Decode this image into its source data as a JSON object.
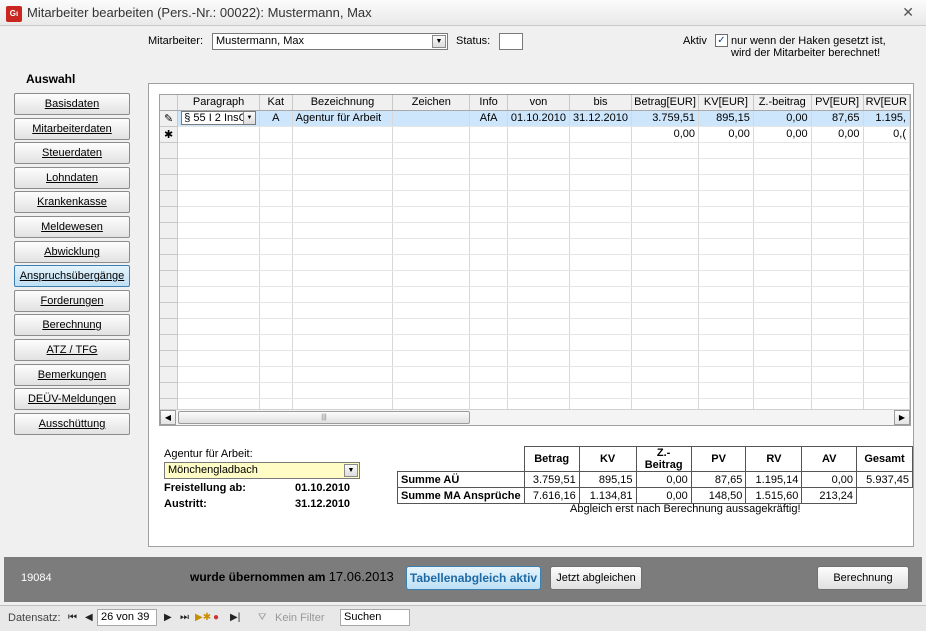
{
  "window": {
    "title": "Mitarbeiter bearbeiten (Pers.-Nr.: 00022): Mustermann, Max",
    "icon_text": "Gı",
    "close_glyph": "✕"
  },
  "header": {
    "mitarbeiter_label": "Mitarbeiter:",
    "mitarbeiter_value": "Mustermann, Max",
    "status_label": "Status:",
    "aktiv_label": "Aktiv",
    "aktiv_checked": "✓",
    "aktiv_hint_1": "nur wenn der Haken gesetzt ist,",
    "aktiv_hint_2": "wird der Mitarbeiter berechnet!"
  },
  "sidebar": {
    "heading": "Auswahl",
    "items": [
      {
        "label": "Basisdaten"
      },
      {
        "label": "Mitarbeiterdaten"
      },
      {
        "label": "Steuerdaten"
      },
      {
        "label": "Lohndaten"
      },
      {
        "label": "Krankenkasse"
      },
      {
        "label": "Meldewesen"
      },
      {
        "label": "Abwicklung"
      },
      {
        "label": "Anspruchsübergänge"
      },
      {
        "label": "Forderungen"
      },
      {
        "label": "Berechnung"
      },
      {
        "label": "ATZ / TFG"
      },
      {
        "label": "Bemerkungen"
      },
      {
        "label": "DEÜV-Meldungen"
      },
      {
        "label": "Ausschüttung"
      }
    ],
    "active_index": 7
  },
  "grid": {
    "columns": [
      "Paragraph",
      "Kat",
      "Bezeichnung",
      "Zeichen",
      "Info",
      "von",
      "bis",
      "Betrag[EUR]",
      "KV[EUR]",
      "Z.-beitrag",
      "PV[EUR]",
      "RV[EUR"
    ],
    "row1": {
      "selector": "✎",
      "paragraph": "§ 55 I 2 InsO",
      "kat": "A",
      "bezeichnung": "Agentur für Arbeit",
      "zeichen": "",
      "info": "AfA",
      "von": "01.10.2010",
      "bis": "31.12.2010",
      "betrag": "3.759,51",
      "kv": "895,15",
      "zbeitrag": "0,00",
      "pv": "87,65",
      "rv": "1.195,"
    },
    "row2": {
      "selector": "✱",
      "betrag": "0,00",
      "kv": "0,00",
      "zbeitrag": "0,00",
      "pv": "0,00",
      "rv": "0,("
    }
  },
  "detail": {
    "agentur_label": "Agentur für Arbeit:",
    "agentur_value": "Mönchengladbach",
    "freistellung_label": "Freistellung ab:",
    "freistellung_value": "01.10.2010",
    "austritt_label": "Austritt:",
    "austritt_value": "31.12.2010"
  },
  "summary": {
    "headers": [
      "Betrag",
      "KV",
      "Z.-Beitrag",
      "PV",
      "RV",
      "AV",
      "Gesamt"
    ],
    "rows": [
      {
        "label": "Summe AÜ",
        "values": [
          "3.759,51",
          "895,15",
          "0,00",
          "87,65",
          "1.195,14",
          "0,00",
          "5.937,45"
        ]
      },
      {
        "label": "Summe MA Ansprüche",
        "values": [
          "7.616,16",
          "1.134,81",
          "0,00",
          "148,50",
          "1.515,60",
          "213,24",
          ""
        ]
      }
    ],
    "note": "Abgleich erst nach Berechnung aussagekräftig!"
  },
  "bottom": {
    "pers_nr": "19084",
    "uebernommen_label": "wurde übernommen am",
    "uebernommen_date": "17.06.2013",
    "tabellenabgleich_label": "Tabellenabgleich aktiv",
    "jetzt_label": "Jetzt abgleichen",
    "berechnung_label": "Berechnung"
  },
  "recnav": {
    "label": "Datensatz:",
    "position": "26 von 39",
    "filter_label": "Kein Filter",
    "search_value": "Suchen"
  }
}
